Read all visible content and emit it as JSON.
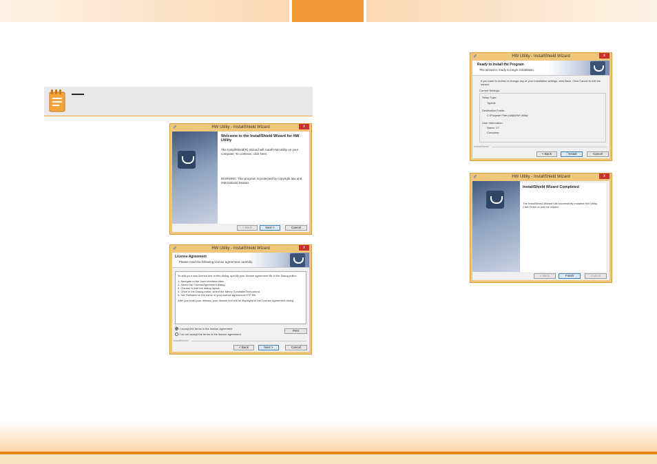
{
  "win_welcome": {
    "title": "HW Utility - InstallShield Wizard",
    "close": "x",
    "heading": "Welcome to the InstallShield Wizard for HW Utility",
    "body": "The InstallShield(R) Wizard will install HW Utility on your computer. To continue, click Next.",
    "warning": "WARNING: This program is protected by copyright law and international treaties.",
    "back": "< Back",
    "next": "Next >",
    "cancel": "Cancel"
  },
  "win_license": {
    "title": "HW Utility - InstallShield Wizard",
    "close": "x",
    "heading": "License Agreement",
    "sub": "Please read the following license agreement carefully.",
    "intro": "To add your own license text to this dialog, specify your license agreement file in the Dialog editor.",
    "steps": [
      "1.   Navigate to the User Interface view.",
      "2.   Select the LicenseAgreement dialog.",
      "3.   Choose to edit the dialog layout.",
      "4.   Once in the Dialog editor, select the Memo ScrollableText control.",
      "5.   Set FileName to the name of your license agreement RTF file."
    ],
    "after": "After you build your release, your license text will be displayed in the License Agreement dialog.",
    "accept": "I accept the terms in the license agreement",
    "decline": "I do not accept the terms in the license agreement",
    "print": "Print",
    "brand": "InstallShield",
    "back": "< Back",
    "next": "Next >",
    "cancel": "Cancel"
  },
  "win_ready": {
    "title": "HW Utility - InstallShield Wizard",
    "close": "x",
    "heading": "Ready to Install the Program",
    "sub": "The wizard is ready to begin installation.",
    "intro": "If you want to review or change any of your installation settings, click Back. Click Cancel to exit the wizard.",
    "current": "Current Settings:",
    "setup_type_label": "Setup Type:",
    "setup_type": "Typical",
    "dest_label": "Destination Folder:",
    "dest": "C:\\Program Files (x86)\\HW Utility\\",
    "user_label": "User Information:",
    "name": "Name: CT",
    "company": "Company:",
    "brand": "InstallShield",
    "back": "< Back",
    "install": "Install",
    "cancel": "Cancel"
  },
  "win_done": {
    "title": "HW Utility - InstallShield Wizard",
    "close": "x",
    "heading": "InstallShield Wizard Completed",
    "body": "The InstallShield Wizard has successfully installed HW Utility. Click Finish to exit the wizard.",
    "back": "< Back",
    "finish": "Finish",
    "cancel": "Cancel"
  },
  "colors": {
    "accent": "#f39a3a",
    "footer_line": "#e8860f",
    "note_bg": "#e9e9e9",
    "close_red": "#c9302c"
  }
}
